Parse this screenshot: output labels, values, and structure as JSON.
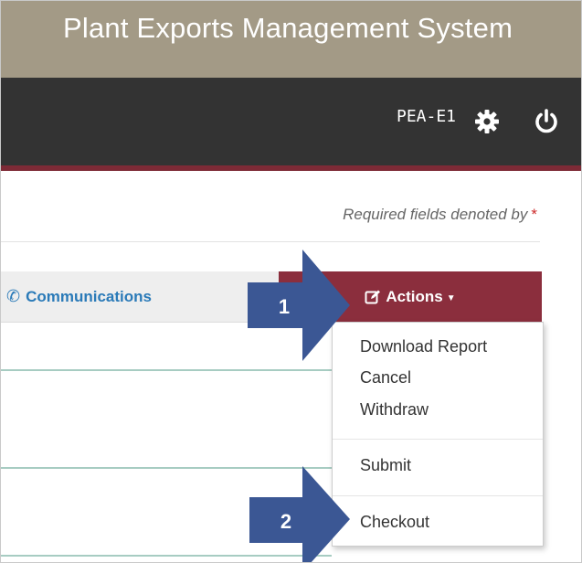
{
  "app": {
    "title": "Plant Exports Management System"
  },
  "nav": {
    "user_id": "PEA-E1",
    "settings_icon": "gear-icon",
    "logout_icon": "power-icon"
  },
  "form": {
    "required_note": "Required fields denoted by",
    "required_marker": "*"
  },
  "tabs": {
    "communications": {
      "label": "Communications",
      "icon": "phone-icon"
    }
  },
  "actions": {
    "label": "Actions",
    "icon": "edit-icon",
    "caret_icon": "caret-down-icon",
    "menu_items": [
      {
        "label": "Download Report"
      },
      {
        "label": "Cancel"
      },
      {
        "label": "Withdraw"
      },
      {
        "label": "Submit"
      },
      {
        "label": "Checkout"
      }
    ]
  },
  "callouts": [
    {
      "label": "1"
    },
    {
      "label": "2"
    }
  ],
  "colors": {
    "title_bar": "#a39a86",
    "nav_bar": "#333333",
    "accent_maroon": "#8b2e3d",
    "link_blue": "#2a7ab8",
    "callout_blue": "#3b5794"
  }
}
